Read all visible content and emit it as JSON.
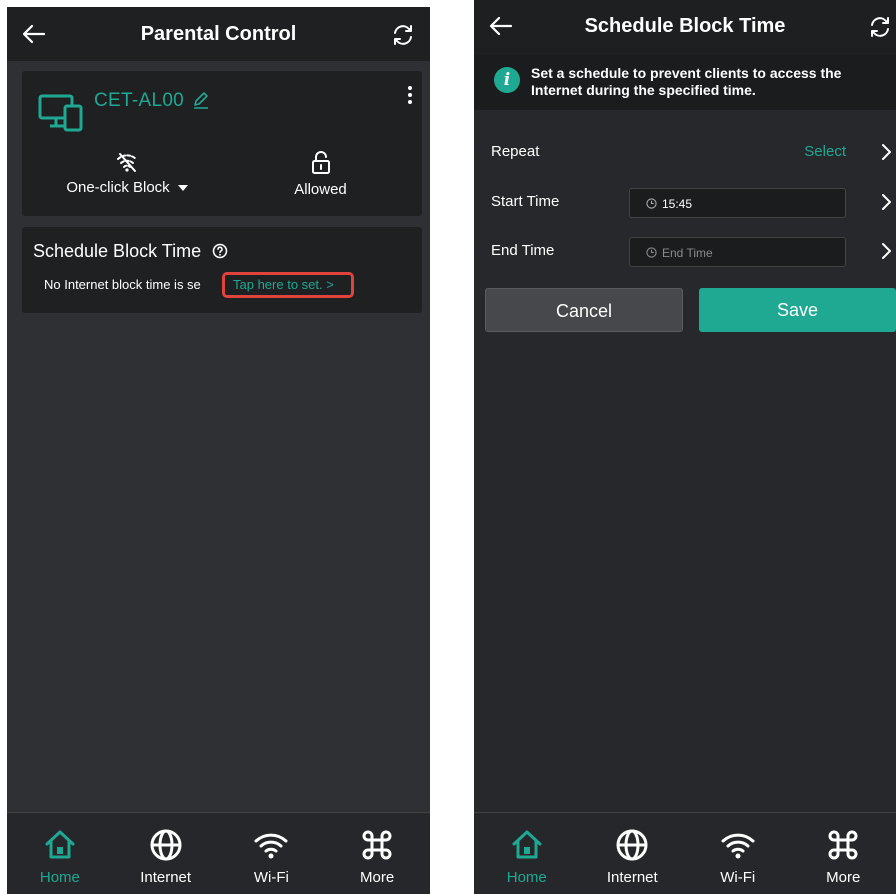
{
  "left_screen": {
    "header": {
      "title": "Parental Control"
    },
    "device": {
      "name": "CET-AL00",
      "block_action_label": "One-click Block",
      "status_label": "Allowed"
    },
    "schedule": {
      "title": "Schedule Block Time",
      "message": "No Internet block time is se",
      "link_label": "Tap here to set. >"
    },
    "nav": [
      {
        "label": "Home",
        "icon": "home-icon",
        "active": true
      },
      {
        "label": "Internet",
        "icon": "globe-icon",
        "active": false
      },
      {
        "label": "Wi-Fi",
        "icon": "wifi-icon",
        "active": false
      },
      {
        "label": "More",
        "icon": "command-icon",
        "active": false
      }
    ]
  },
  "right_screen": {
    "header": {
      "title": "Schedule Block Time"
    },
    "info": {
      "text": "Set a schedule to prevent clients to access the Internet during the specified time.",
      "icon_letter": "i"
    },
    "form": {
      "repeat_label": "Repeat",
      "repeat_value": "Select",
      "start_label": "Start Time",
      "start_value": "15:45",
      "end_label": "End Time",
      "end_placeholder": "End Time"
    },
    "buttons": {
      "cancel": "Cancel",
      "save": "Save"
    },
    "nav": [
      {
        "label": "Home",
        "icon": "home-icon",
        "active": true
      },
      {
        "label": "Internet",
        "icon": "globe-icon",
        "active": false
      },
      {
        "label": "Wi-Fi",
        "icon": "wifi-icon",
        "active": false
      },
      {
        "label": "More",
        "icon": "command-icon",
        "active": false
      }
    ]
  },
  "colors": {
    "accent": "#1fa892",
    "highlight": "#e0423c",
    "background": "#2f3033"
  }
}
